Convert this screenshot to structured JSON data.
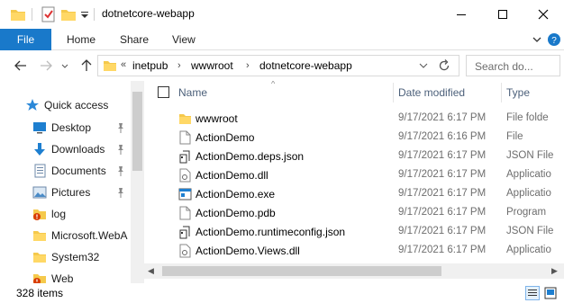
{
  "window": {
    "title": "dotnetcore-webapp",
    "controls": [
      "minimize-icon",
      "maximize-icon",
      "close-icon"
    ]
  },
  "ribbon": {
    "tabs": [
      "File",
      "Home",
      "Share",
      "View"
    ],
    "accent": "#1979ca"
  },
  "address": {
    "breadcrumbs": [
      "«",
      "inetpub",
      "wwwroot",
      "dotnetcore-webapp"
    ],
    "search_placeholder": "Search do..."
  },
  "nav": {
    "items": [
      {
        "label": "Quick access",
        "icon": "star-icon",
        "pinned": false
      },
      {
        "label": "Desktop",
        "icon": "desktop-icon",
        "pinned": true
      },
      {
        "label": "Downloads",
        "icon": "download-icon",
        "pinned": true
      },
      {
        "label": "Documents",
        "icon": "documents-icon",
        "pinned": true
      },
      {
        "label": "Pictures",
        "icon": "pictures-icon",
        "pinned": true
      },
      {
        "label": "log",
        "icon": "folder-warning-icon",
        "pinned": false
      },
      {
        "label": "Microsoft.WebA",
        "icon": "folder-icon",
        "pinned": false
      },
      {
        "label": "System32",
        "icon": "folder-icon",
        "pinned": false
      },
      {
        "label": "Web",
        "icon": "folder-warning-icon",
        "pinned": false
      }
    ]
  },
  "columns": {
    "name": "Name",
    "date": "Date modified",
    "type": "Type"
  },
  "files": [
    {
      "name": "wwwroot",
      "date": "9/17/2021 6:17 PM",
      "type": "File folde",
      "icon": "folder-icon"
    },
    {
      "name": "ActionDemo",
      "date": "9/17/2021 6:16 PM",
      "type": "File",
      "icon": "file-icon"
    },
    {
      "name": "ActionDemo.deps.json",
      "date": "9/17/2021 6:17 PM",
      "type": "JSON File",
      "icon": "json-file-icon"
    },
    {
      "name": "ActionDemo.dll",
      "date": "9/17/2021 6:17 PM",
      "type": "Applicatio",
      "icon": "dll-icon"
    },
    {
      "name": "ActionDemo.exe",
      "date": "9/17/2021 6:17 PM",
      "type": "Applicatio",
      "icon": "exe-icon"
    },
    {
      "name": "ActionDemo.pdb",
      "date": "9/17/2021 6:17 PM",
      "type": "Program",
      "icon": "file-icon"
    },
    {
      "name": "ActionDemo.runtimeconfig.json",
      "date": "9/17/2021 6:17 PM",
      "type": "JSON File",
      "icon": "json-file-icon"
    },
    {
      "name": "ActionDemo.Views.dll",
      "date": "9/17/2021 6:17 PM",
      "type": "Applicatio",
      "icon": "dll-icon"
    }
  ],
  "status": {
    "item_count": "328 items"
  }
}
